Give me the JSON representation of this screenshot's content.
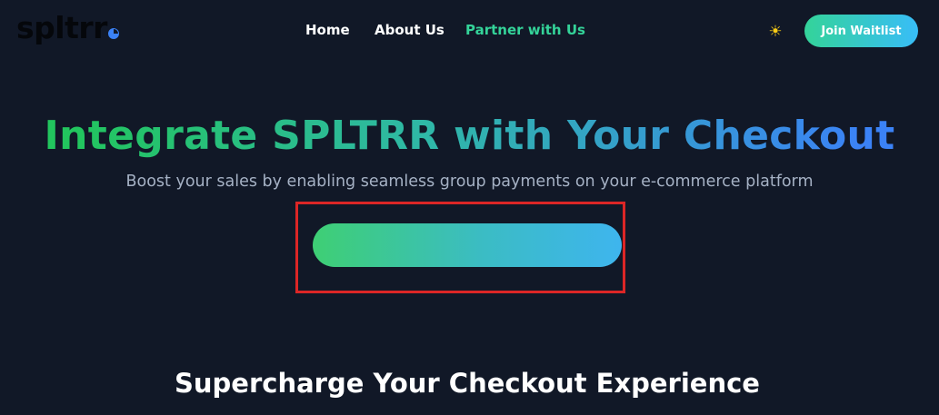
{
  "header": {
    "logo_text": "spltrr",
    "nav": {
      "home": "Home",
      "about": "About Us",
      "partner": "Partner with Us"
    },
    "theme_toggle_icon": "sun-icon",
    "join_label": "Join Waitlist"
  },
  "hero": {
    "title": "Integrate SPLTRR with Your Checkout",
    "subtitle": "Boost your sales by enabling seamless group payments on your e-commerce platform",
    "cta_label": ""
  },
  "section": {
    "heading": "Supercharge Your Checkout Experience"
  },
  "colors": {
    "background": "#111827",
    "accent_green": "#34d399",
    "accent_blue": "#3b82f6",
    "highlight_red": "#dc2626"
  }
}
